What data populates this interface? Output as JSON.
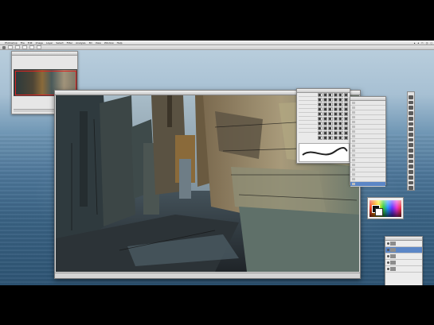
{
  "menubar": {
    "apple": "",
    "items": [
      "Photoshop",
      "File",
      "Edit",
      "Image",
      "Layer",
      "Select",
      "Filter",
      "Analysis",
      "3D",
      "View",
      "Window",
      "Help"
    ]
  },
  "toolstrip_icons": [
    "move-icon",
    "marquee-icon",
    "lasso-icon",
    "wand-icon",
    "crop-icon",
    "eyedropper-icon",
    "heal-icon",
    "brush-icon",
    "stamp-icon",
    "history-brush-icon",
    "eraser-icon",
    "gradient-icon",
    "blur-icon",
    "dodge-icon",
    "pen-icon",
    "type-icon",
    "path-select-icon",
    "shape-icon",
    "hand-icon",
    "zoom-icon"
  ],
  "colors": {
    "selection_blue": "#5b86c6",
    "desktop_sky": "#a7c0d3",
    "desktop_sea": "#3a6384"
  }
}
